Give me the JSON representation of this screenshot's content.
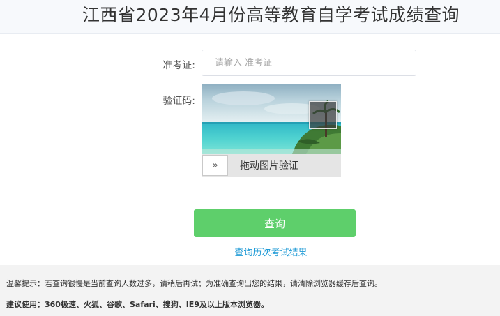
{
  "header": {
    "title": "江西省2023年4月份高等教育自学考试成绩查询"
  },
  "form": {
    "ticket_label": "准考证:",
    "ticket_placeholder": "请输入 准考证",
    "ticket_value": "",
    "captcha_label": "验证码:",
    "slider_handle_glyph": "»",
    "slider_text": "拖动图片验证"
  },
  "actions": {
    "query_label": "查询",
    "history_link": "查询历次考试结果"
  },
  "footer": {
    "tip": "温馨提示：若查询很慢是当前查询人数过多，请稍后再试；为准确查询出您的结果，请清除浏览器缓存后查询。",
    "recommend": "建议使用：360极速、火狐、谷歌、Safari、搜狗、IE9及以上版本浏览器。"
  },
  "colors": {
    "query_button": "#5ecf6b",
    "link": "#1e9ad6",
    "header_bg": "#f7f9fc",
    "footer_bg": "#f3f3f3"
  },
  "icons": {
    "slider_handle": "double-chevron-right-icon"
  }
}
